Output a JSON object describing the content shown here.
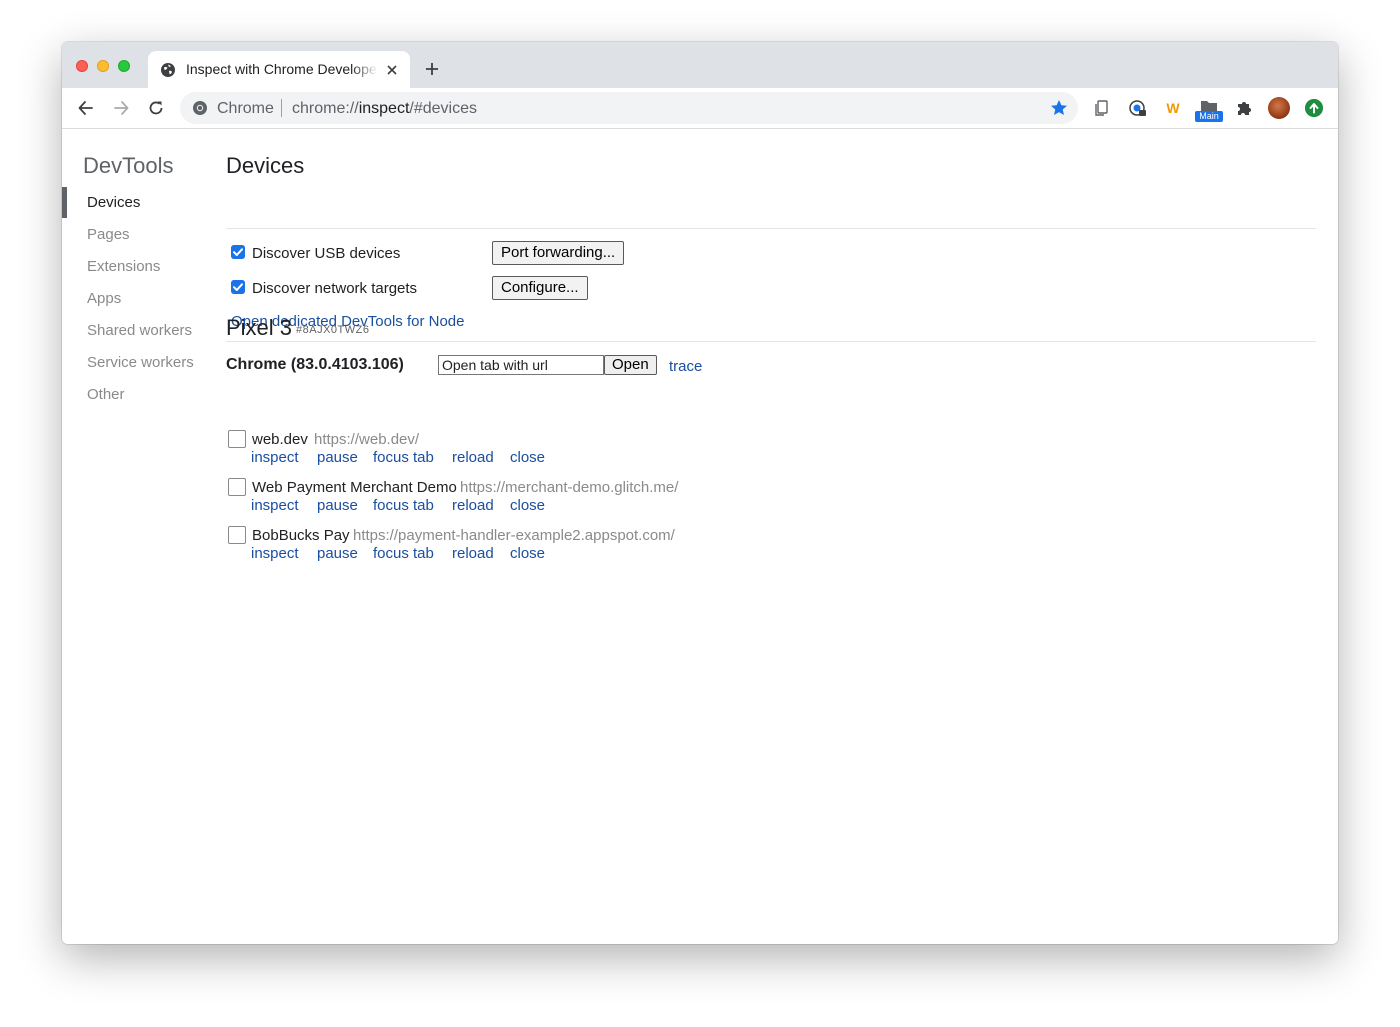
{
  "browser": {
    "tab": {
      "title": "Inspect with Chrome Developer Tools"
    },
    "omnibox": {
      "site_chip": "Chrome",
      "url_scheme": "chrome://",
      "url_host": "inspect",
      "url_rest": "/#devices"
    },
    "extensions": {
      "w_label": "W",
      "main_badge": "Main"
    }
  },
  "sidebar": {
    "title": "DevTools",
    "items": [
      {
        "label": "Devices",
        "active": true
      },
      {
        "label": "Pages"
      },
      {
        "label": "Extensions"
      },
      {
        "label": "Apps"
      },
      {
        "label": "Shared workers"
      },
      {
        "label": "Service workers"
      },
      {
        "label": "Other"
      }
    ]
  },
  "main": {
    "title": "Devices",
    "options": {
      "usb_label": "Discover USB devices",
      "usb_checked": true,
      "port_forwarding_label": "Port forwarding...",
      "network_label": "Discover network targets",
      "network_checked": true,
      "configure_label": "Configure...",
      "node_link": "Open dedicated DevTools for Node"
    },
    "device": {
      "name": "Pixel 3",
      "serial": "#8AJX0TWZ6",
      "browser": "Chrome (83.0.4103.106)",
      "open_tab_placeholder": "Open tab with url",
      "open_label": "Open",
      "trace_label": "trace",
      "targets": [
        {
          "name": "web.dev",
          "url": "https://web.dev/",
          "checked": false
        },
        {
          "name": "Web Payment Merchant Demo",
          "url": "https://merchant-demo.glitch.me/",
          "checked": false
        },
        {
          "name": "BobBucks Pay",
          "url": "https://payment-handler-example2.appspot.com/",
          "checked": false
        }
      ],
      "actions": {
        "inspect": "inspect",
        "pause": "pause",
        "focus_tab": "focus tab",
        "reload": "reload",
        "close": "close"
      }
    }
  },
  "colors": {
    "link": "#1a4fa0",
    "checkbox_checked": "#1a73e8",
    "star": "#1a73e8",
    "update": "#1e8e3e"
  }
}
